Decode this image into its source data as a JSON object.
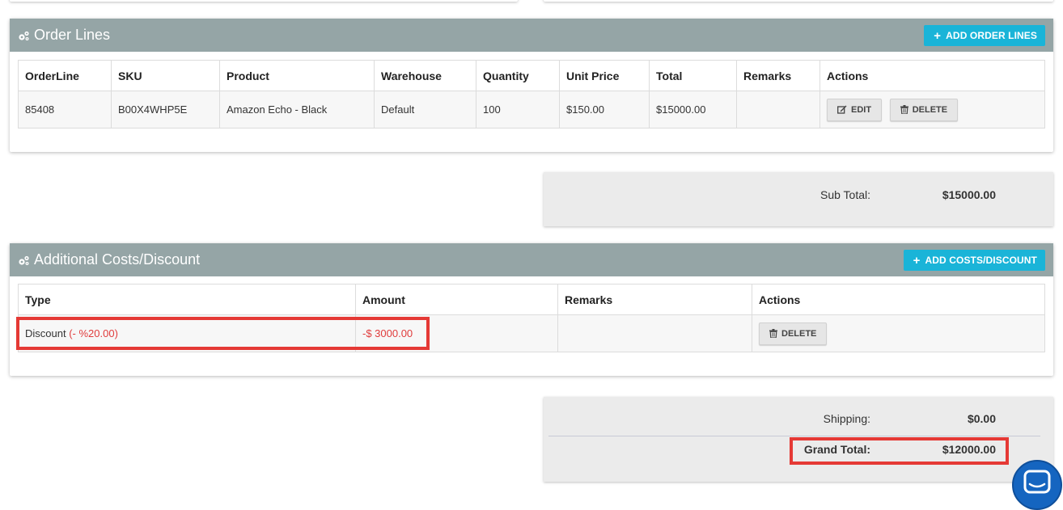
{
  "order_lines": {
    "title": "Order Lines",
    "add_button": "ADD ORDER LINES",
    "columns": [
      "OrderLine",
      "SKU",
      "Product",
      "Warehouse",
      "Quantity",
      "Unit Price",
      "Total",
      "Remarks",
      "Actions"
    ],
    "rows": [
      {
        "orderline": "85408",
        "sku": "B00X4WHP5E",
        "product": "Amazon Echo - Black",
        "warehouse": "Default",
        "quantity": "100",
        "unit_price": "$150.00",
        "total": "$15000.00",
        "remarks": "",
        "edit_label": "EDIT",
        "delete_label": "DELETE"
      }
    ]
  },
  "subtotal": {
    "label": "Sub Total:",
    "value": "$15000.00"
  },
  "costs": {
    "title": "Additional Costs/Discount",
    "add_button": "ADD COSTS/DISCOUNT",
    "columns": [
      "Type",
      "Amount",
      "Remarks",
      "Actions"
    ],
    "rows": [
      {
        "type": "Discount",
        "type_detail": "(- %20.00)",
        "amount": "-$ 3000.00",
        "remarks": "",
        "delete_label": "DELETE"
      }
    ]
  },
  "totals": {
    "shipping_label": "Shipping:",
    "shipping_value": "$0.00",
    "grand_label": "Grand Total:",
    "grand_value": "$12000.00"
  },
  "colors": {
    "panel_header": "#95a5a6",
    "accent_button": "#1ab4d8",
    "discount_text": "#e03c3c",
    "highlight": "#e53935",
    "chat_button": "#1565c0"
  },
  "icons": {
    "panel_header": "cogs-icon",
    "add_buttons": "plus-icon",
    "edit": "edit-icon",
    "delete": "trash-icon",
    "chat": "chat-icon"
  }
}
